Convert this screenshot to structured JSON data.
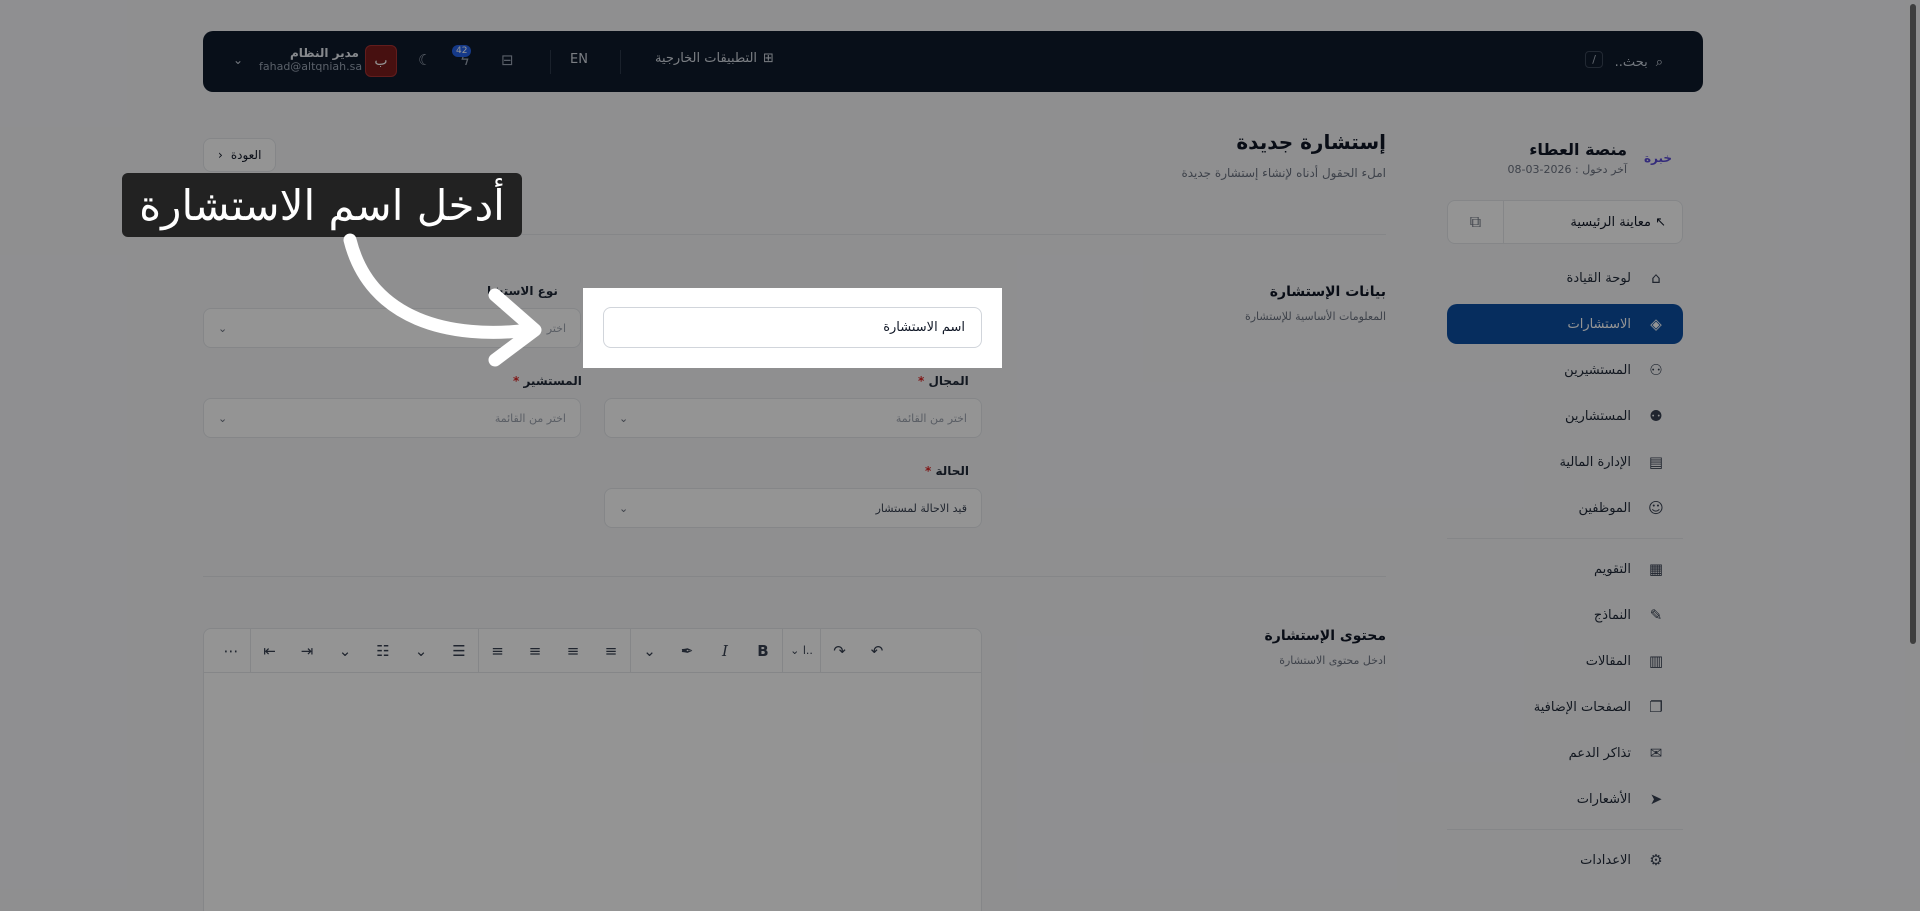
{
  "topbar": {
    "search_placeholder": "بحث..",
    "search_shortcut": "/",
    "external_apps": "التطبيقات الخارجية",
    "lang": "EN",
    "notifications_count": "42",
    "user_name": "مدير النظام",
    "user_email": "fahad@altqniah.sa"
  },
  "sidebar": {
    "brand_title": "منصة العطاء",
    "brand_logo": "خبرة",
    "last_login": "آخر دخول : 2026-03-08",
    "preview_label": "معاينة الرئيسية",
    "items": [
      {
        "label": "لوحة القيادة",
        "icon": "dashboard-icon",
        "glyph": "⌂"
      },
      {
        "label": "الاستشارات",
        "icon": "layers-icon",
        "glyph": "◈"
      },
      {
        "label": "المستشيرين",
        "icon": "users-icon",
        "glyph": "⚇"
      },
      {
        "label": "المستشارين",
        "icon": "consultant-icon",
        "glyph": "⚉"
      },
      {
        "label": "الإدارة المالية",
        "icon": "finance-icon",
        "glyph": "▤"
      },
      {
        "label": "الموظفين",
        "icon": "employee-icon",
        "glyph": "☺"
      }
    ],
    "items2": [
      {
        "label": "التقويم",
        "icon": "calendar-icon",
        "glyph": "▦"
      },
      {
        "label": "النماذج",
        "icon": "forms-icon",
        "glyph": "✎"
      },
      {
        "label": "المقالات",
        "icon": "articles-icon",
        "glyph": "▥"
      },
      {
        "label": "الصفحات الإضافية",
        "icon": "pages-icon",
        "glyph": "❐"
      },
      {
        "label": "تذاكر الدعم",
        "icon": "tickets-icon",
        "glyph": "✉"
      },
      {
        "label": "الأشعارات",
        "icon": "send-icon",
        "glyph": "➤"
      }
    ],
    "settings_label": "الاعدادات"
  },
  "main": {
    "title": "إستشارة جديدة",
    "subtitle": "املء الحقول أدناه لإنشاء إستشارة جديدة",
    "back": "العودة",
    "section1_title": "بيانات الإستشارة",
    "section1_sub": "المعلومات الأساسية للإستشارة",
    "type_label": "نوع الاستشا",
    "field_label": "المجال",
    "consultant_label": "المستشير",
    "status_label": "الحالة",
    "select_placeholder": "اختر من القائمة",
    "type_placeholder_partial": "اختر",
    "status_value": "قيد الاحالة لمستشار",
    "section2_title": "محتوى الإستشارة",
    "section2_sub": "ادخل محتوى الاستشارة",
    "heading_dropdown": "ا.."
  },
  "overlay": {
    "tooltip": "أدخل اسم الاستشارة",
    "input_placeholder": "اسم الاستشارة"
  }
}
